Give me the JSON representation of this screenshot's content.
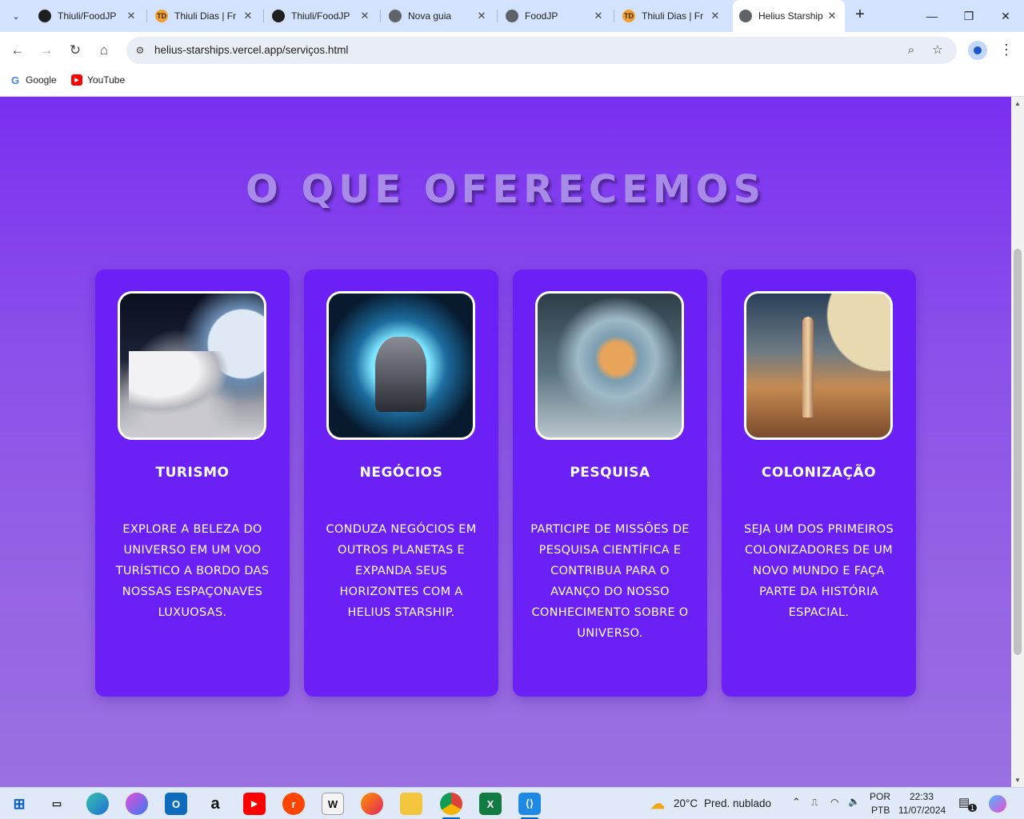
{
  "browser": {
    "tabs": [
      {
        "title": "Thiuli/FoodJP",
        "icon": "github-icon",
        "active": false
      },
      {
        "title": "Thiuli Dias | Fr",
        "icon": "td-icon",
        "active": false
      },
      {
        "title": "Thiuli/FoodJP",
        "icon": "github-icon",
        "active": false
      },
      {
        "title": "Nova guia",
        "icon": "chrome-icon",
        "active": false
      },
      {
        "title": "FoodJP",
        "icon": "globe-icon",
        "active": false
      },
      {
        "title": "Thiuli Dias | Fr",
        "icon": "td-icon",
        "active": false
      },
      {
        "title": "Helius Starship",
        "icon": "globe-icon",
        "active": true
      }
    ],
    "url": "helius-starships.vercel.app/serviços.html",
    "bookmarks": [
      {
        "label": "Google",
        "icon": "google-icon"
      },
      {
        "label": "YouTube",
        "icon": "youtube-icon"
      }
    ]
  },
  "page": {
    "section_title": "O QUE OFERECEMOS",
    "cards": [
      {
        "title": "TURISMO",
        "text": "EXPLORE A BELEZA DO UNIVERSO EM UM VOO TURÍSTICO A BORDO DAS NOSSAS ESPAÇONAVES LUXUOSAS."
      },
      {
        "title": "NEGÓCIOS",
        "text": "CONDUZA NEGÓCIOS EM OUTROS PLANETAS E EXPANDA SEUS HORIZONTES COM A HELIUS STARSHIP."
      },
      {
        "title": "PESQUISA",
        "text": "PARTICIPE DE MISSÕES DE PESQUISA CIENTÍFICA E CONTRIBUA PARA O AVANÇO DO NOSSO CONHECIMENTO SOBRE O UNIVERSO."
      },
      {
        "title": "COLONIZAÇÃO",
        "text": "SEJA UM DOS PRIMEIROS COLONIZADORES DE UM NOVO MUNDO E FAÇA PARTE DA HISTÓRIA ESPACIAL."
      }
    ]
  },
  "taskbar": {
    "weather": {
      "temp": "20°C",
      "desc": "Pred. nublado"
    },
    "lang": {
      "line1": "POR",
      "line2": "PTB"
    },
    "clock": {
      "time": "22:33",
      "date": "11/07/2024"
    },
    "notifications": "1"
  },
  "colors": {
    "page_accent": "#6b21f5",
    "title_color": "#a88ae8"
  }
}
